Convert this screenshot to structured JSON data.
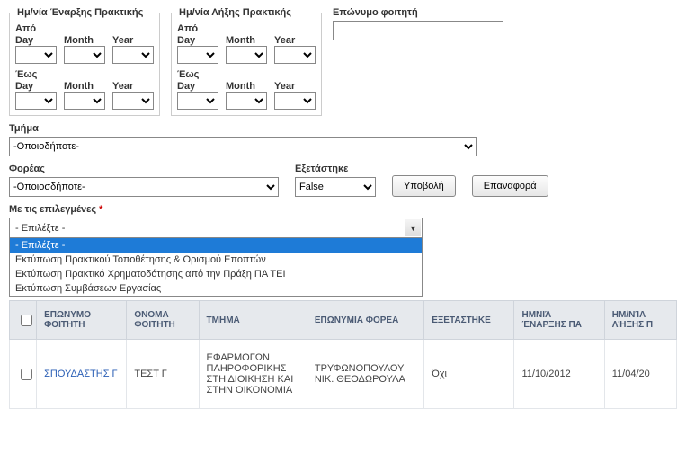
{
  "filters": {
    "start_box_legend": "Ημ/νία Έναρξης Πρακτικής",
    "end_box_legend": "Ημ/νία Λήξης Πρακτικής",
    "from_label": "Από",
    "to_label": "Έως",
    "day_label": "Day",
    "month_label": "Month",
    "year_label": "Year",
    "surname_label": "Επώνυμο φοιτητή",
    "surname_value": "",
    "dept_label": "Τμήμα",
    "dept_value": "-Οποιοδήποτε-",
    "body_label": "Φορέας",
    "body_value": "-Οποιοσδήποτε-",
    "examined_label": "Εξετάστηκε",
    "examined_value": "False",
    "submit": "Υποβολή",
    "reset": "Επαναφορά"
  },
  "bulk": {
    "label": "Με τις επιλεγμένες",
    "star": "*",
    "selected": "- Επιλέξτε -",
    "options": [
      "- Επιλέξτε -",
      "Εκτύπωση Πρακτικού Τοποθέτησης & Ορισμού Εποπτών",
      "Εκτύπωση Πρακτικό Χρηματοδότησης από την Πράξη ΠΑ ΤΕΙ",
      "Εκτύπωση Συμβάσεων Εργασίας"
    ]
  },
  "table": {
    "headers": {
      "surname": "ΕΠΩΝΥΜΟ ΦΟΙΤΗΤΗ",
      "name": "ΟΝΟΜΑ ΦΟΙΤΗΤΗ",
      "dept": "ΤΜΗΜΑ",
      "body": "ΕΠΩΝΥΜΙΑ ΦΟΡΕΑ",
      "examined": "ΕΞΕΤΑΣΤΗΚΕ",
      "start": "ΗΜΝΙΆ ΈΝΑΡΞΗΣ ΠΑ",
      "end": "ΗΜ/ΝΊΑ ΛΉΞΗΣ Π"
    },
    "rows": [
      {
        "surname": "ΣΠΟΥΔΑΣΤΗΣ Γ",
        "name": "ΤΕΣΤ Γ",
        "dept": "ΕΦΑΡΜΟΓΩΝ ΠΛΗΡΟΦΟΡΙΚΗΣ ΣΤΗ ΔΙΟΙΚΗΣΗ ΚΑΙ ΣΤΗΝ ΟΙΚΟΝΟΜΙΑ",
        "body": "ΤΡΥΦΩΝΟΠΟΥΛΟΥ ΝΙΚ. ΘΕΟΔΩΡΟΥΛΑ",
        "examined": "Όχι",
        "start": "11/10/2012",
        "end": "11/04/20"
      }
    ]
  }
}
